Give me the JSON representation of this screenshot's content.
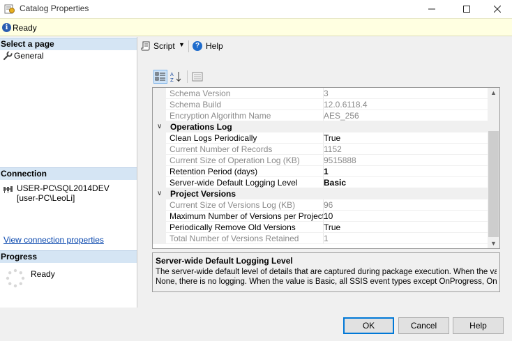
{
  "window": {
    "title": "Catalog Properties",
    "status_text": "Ready"
  },
  "left_panel": {
    "select_page_header": "Select a page",
    "pages": [
      {
        "label": "General",
        "icon": "wrench-icon"
      }
    ],
    "connection_header": "Connection",
    "connection_server": "USER-PC\\SQL2014DEV",
    "connection_user": "[user-PC\\LeoLi]",
    "view_connection_link": "View connection properties",
    "progress_header": "Progress",
    "progress_status": "Ready"
  },
  "toolbar": {
    "script_label": "Script",
    "help_label": "Help"
  },
  "property_grid": {
    "rows": [
      {
        "type": "prop",
        "name": "Schema Version",
        "value": "3",
        "readonly": true
      },
      {
        "type": "prop",
        "name": "Schema Build",
        "value": "12.0.6118.4",
        "readonly": true
      },
      {
        "type": "prop",
        "name": "Encryption Algorithm Name",
        "value": "AES_256",
        "readonly": true
      },
      {
        "type": "category",
        "name": "Operations Log"
      },
      {
        "type": "prop",
        "name": "Clean Logs Periodically",
        "value": "True",
        "readonly": false
      },
      {
        "type": "prop",
        "name": "Current Number of Records",
        "value": "1152",
        "readonly": true
      },
      {
        "type": "prop",
        "name": "Current Size of Operation Log (KB)",
        "value": "9515888",
        "readonly": true
      },
      {
        "type": "prop",
        "name": "Retention Period (days)",
        "value": "1",
        "readonly": false,
        "bold": true
      },
      {
        "type": "prop",
        "name": "Server-wide Default Logging Level",
        "value": "Basic",
        "readonly": false,
        "bold": true
      },
      {
        "type": "category",
        "name": "Project Versions"
      },
      {
        "type": "prop",
        "name": "Current Size of Versions Log (KB)",
        "value": "96",
        "readonly": true
      },
      {
        "type": "prop",
        "name": "Maximum Number of Versions per Project",
        "value": "10",
        "readonly": false
      },
      {
        "type": "prop",
        "name": "Periodically Remove Old Versions",
        "value": "True",
        "readonly": false
      },
      {
        "type": "prop",
        "name": "Total Number of Versions Retained",
        "value": "1",
        "readonly": true
      }
    ]
  },
  "description": {
    "title": "Server-wide Default Logging Level",
    "line1": "The server-wide default level of details that are captured during package execution. When the value is",
    "line2": "None, there is no logging. When the value is Basic, all SSIS event types except OnProgress, OnCust..."
  },
  "buttons": {
    "ok": "OK",
    "cancel": "Cancel",
    "help": "Help"
  },
  "colors": {
    "section_header": "#d5e5f4",
    "status_bar": "#ffffe1",
    "link": "#0645ad",
    "default_button_border": "#0078d7"
  }
}
